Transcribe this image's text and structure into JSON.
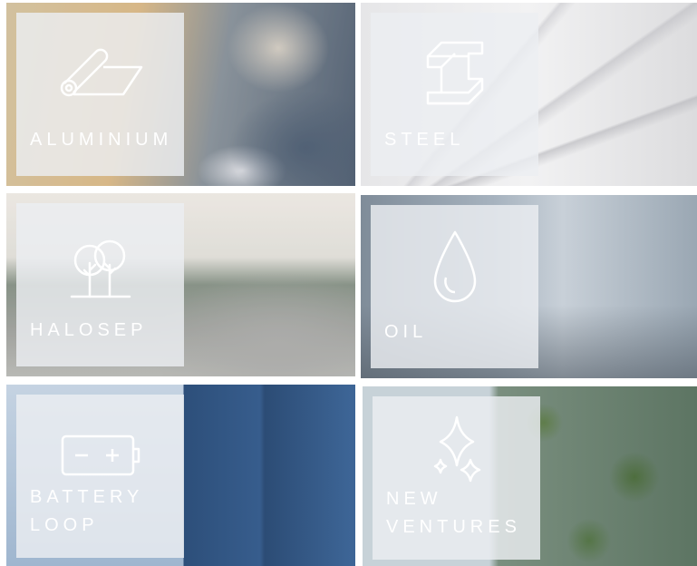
{
  "tiles": [
    {
      "id": "aluminium",
      "label": "ALUMINIUM",
      "icon": "aluminium-roll-icon"
    },
    {
      "id": "steel",
      "label": "STEEL",
      "icon": "steel-beam-icon"
    },
    {
      "id": "halosep",
      "label": "HALOSEP",
      "icon": "trees-icon"
    },
    {
      "id": "oil",
      "label": "OIL",
      "icon": "droplet-icon"
    },
    {
      "id": "battery",
      "label_line1": "BATTERY",
      "label_line2": "LOOP",
      "icon": "battery-icon"
    },
    {
      "id": "new_ventures",
      "label_line1": "NEW",
      "label_line2": "VENTURES",
      "icon": "sparkles-icon"
    }
  ],
  "colors": {
    "panel": "#eceef1",
    "text": "#ffffff"
  }
}
